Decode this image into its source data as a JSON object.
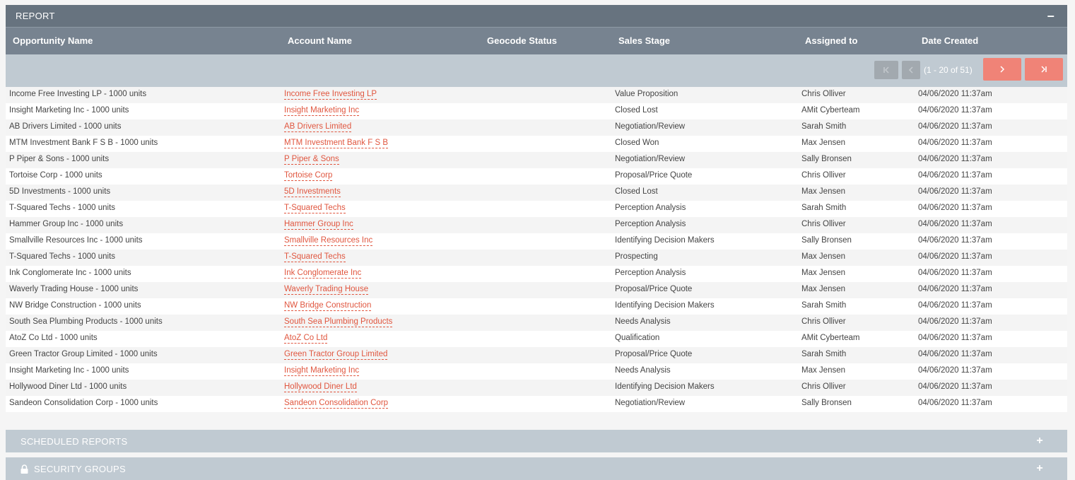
{
  "report": {
    "title": "REPORT",
    "collapse_icon": "minus-icon",
    "collapse_symbol": "–",
    "columns": {
      "opportunity_name": "Opportunity Name",
      "account_name": "Account Name",
      "geocode_status": "Geocode Status",
      "sales_stage": "Sales Stage",
      "assigned_to": "Assigned to",
      "date_created": "Date Created"
    },
    "pagination": {
      "count_text": "(1 - 20 of 51)",
      "first_icon": "first-page-icon",
      "prev_icon": "prev-page-icon",
      "next_icon": "next-page-icon",
      "last_icon": "last-page-icon"
    },
    "rows": [
      {
        "opportunity": "Income Free Investing LP - 1000 units",
        "account": "Income Free Investing LP",
        "stage": "Value Proposition",
        "assigned": "Chris Olliver",
        "date": "04/06/2020 11:37am"
      },
      {
        "opportunity": "Insight Marketing Inc - 1000 units",
        "account": "Insight Marketing Inc",
        "stage": "Closed Lost",
        "assigned": "AMit Cyberteam",
        "date": "04/06/2020 11:37am"
      },
      {
        "opportunity": "AB Drivers Limited - 1000 units",
        "account": "AB Drivers Limited",
        "stage": "Negotiation/Review",
        "assigned": "Sarah Smith",
        "date": "04/06/2020 11:37am"
      },
      {
        "opportunity": "MTM Investment Bank F S B - 1000 units",
        "account": "MTM Investment Bank F S B",
        "stage": "Closed Won",
        "assigned": "Max Jensen",
        "date": "04/06/2020 11:37am"
      },
      {
        "opportunity": "P Piper & Sons - 1000 units",
        "account": "P Piper & Sons",
        "stage": "Negotiation/Review",
        "assigned": "Sally Bronsen",
        "date": "04/06/2020 11:37am"
      },
      {
        "opportunity": "Tortoise Corp - 1000 units",
        "account": "Tortoise Corp",
        "stage": "Proposal/Price Quote",
        "assigned": "Chris Olliver",
        "date": "04/06/2020 11:37am"
      },
      {
        "opportunity": "5D Investments - 1000 units",
        "account": "5D Investments",
        "stage": "Closed Lost",
        "assigned": "Max Jensen",
        "date": "04/06/2020 11:37am"
      },
      {
        "opportunity": "T-Squared Techs - 1000 units",
        "account": "T-Squared Techs",
        "stage": "Perception Analysis",
        "assigned": "Sarah Smith",
        "date": "04/06/2020 11:37am"
      },
      {
        "opportunity": "Hammer Group Inc - 1000 units",
        "account": "Hammer Group Inc",
        "stage": "Perception Analysis",
        "assigned": "Chris Olliver",
        "date": "04/06/2020 11:37am"
      },
      {
        "opportunity": "Smallville Resources Inc - 1000 units",
        "account": "Smallville Resources Inc",
        "stage": "Identifying Decision Makers",
        "assigned": "Sally Bronsen",
        "date": "04/06/2020 11:37am"
      },
      {
        "opportunity": "T-Squared Techs - 1000 units",
        "account": "T-Squared Techs",
        "stage": "Prospecting",
        "assigned": "Max Jensen",
        "date": "04/06/2020 11:37am"
      },
      {
        "opportunity": "Ink Conglomerate Inc - 1000 units",
        "account": "Ink Conglomerate Inc",
        "stage": "Perception Analysis",
        "assigned": "Max Jensen",
        "date": "04/06/2020 11:37am"
      },
      {
        "opportunity": "Waverly Trading House - 1000 units",
        "account": "Waverly Trading House",
        "stage": "Proposal/Price Quote",
        "assigned": "Max Jensen",
        "date": "04/06/2020 11:37am"
      },
      {
        "opportunity": "NW Bridge Construction - 1000 units",
        "account": "NW Bridge Construction",
        "stage": "Identifying Decision Makers",
        "assigned": "Sarah Smith",
        "date": "04/06/2020 11:37am"
      },
      {
        "opportunity": "South Sea Plumbing Products - 1000 units",
        "account": "South Sea Plumbing Products",
        "stage": "Needs Analysis",
        "assigned": "Chris Olliver",
        "date": "04/06/2020 11:37am"
      },
      {
        "opportunity": "AtoZ Co Ltd - 1000 units",
        "account": "AtoZ Co Ltd",
        "stage": "Qualification",
        "assigned": "AMit Cyberteam",
        "date": "04/06/2020 11:37am"
      },
      {
        "opportunity": "Green Tractor Group Limited - 1000 units",
        "account": "Green Tractor Group Limited",
        "stage": "Proposal/Price Quote",
        "assigned": "Sarah Smith",
        "date": "04/06/2020 11:37am"
      },
      {
        "opportunity": "Insight Marketing Inc - 1000 units",
        "account": "Insight Marketing Inc",
        "stage": "Needs Analysis",
        "assigned": "Max Jensen",
        "date": "04/06/2020 11:37am"
      },
      {
        "opportunity": "Hollywood Diner Ltd - 1000 units",
        "account": "Hollywood Diner Ltd",
        "stage": "Identifying Decision Makers",
        "assigned": "Chris Olliver",
        "date": "04/06/2020 11:37am"
      },
      {
        "opportunity": "Sandeon Consolidation Corp - 1000 units",
        "account": "Sandeon Consolidation Corp",
        "stage": "Negotiation/Review",
        "assigned": "Sally Bronsen",
        "date": "04/06/2020 11:37am"
      }
    ]
  },
  "scheduled_reports": {
    "title": "SCHEDULED REPORTS",
    "expand_icon": "plus-icon",
    "expand_symbol": "+"
  },
  "security_groups": {
    "title": "SECURITY GROUPS",
    "lock_icon": "lock-icon",
    "expand_icon": "plus-icon",
    "expand_symbol": "+"
  },
  "colors": {
    "header_dark": "#67737f",
    "column_header": "#778390",
    "pagination_bar": "#c0cad2",
    "accent": "#f08377",
    "link": "#e0563f"
  }
}
